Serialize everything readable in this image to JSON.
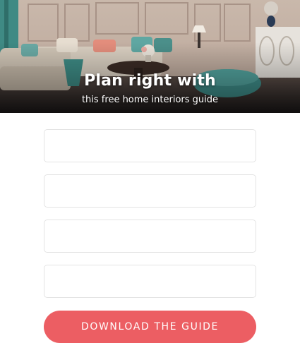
{
  "hero": {
    "title": "Plan right with",
    "subtitle": "this free home interiors guide"
  },
  "form": {
    "fields": [
      {
        "placeholder": ""
      },
      {
        "placeholder": ""
      },
      {
        "placeholder": ""
      },
      {
        "placeholder": ""
      }
    ],
    "submit_label": "DOWNLOAD THE GUIDE"
  },
  "colors": {
    "accent": "#ec5e63",
    "field_border": "#e3e3e3",
    "background": "#ffffff"
  },
  "icons": [
    "room-illustration"
  ]
}
